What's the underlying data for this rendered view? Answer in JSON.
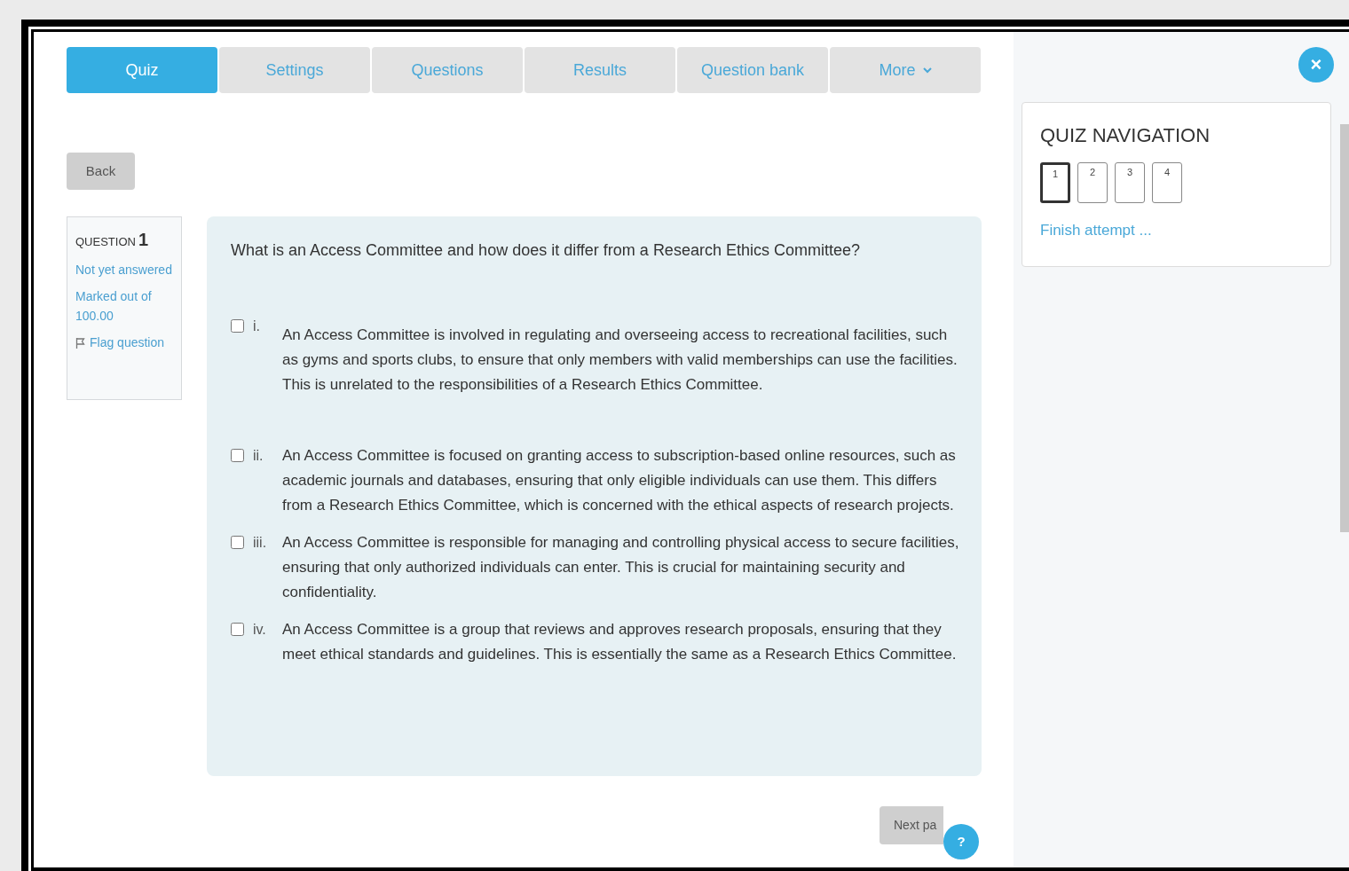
{
  "tabs": [
    {
      "label": "Quiz",
      "selected": true
    },
    {
      "label": "Settings",
      "selected": false
    },
    {
      "label": "Questions",
      "selected": false
    },
    {
      "label": "Results",
      "selected": false
    },
    {
      "label": "Question bank",
      "selected": false
    },
    {
      "label": "More",
      "selected": false,
      "dropdown": true
    }
  ],
  "back_button": "Back",
  "question_info": {
    "heading": "QUESTION",
    "number": "1",
    "state": "Not yet answered",
    "marks": "Marked out of 100.00",
    "flag": "Flag question"
  },
  "question": {
    "text": "What is an Access Committee and how does it differ from a Research Ethics Committee?",
    "options": [
      {
        "label": "i.",
        "checked": false,
        "text": "An Access Committee is involved in regulating and overseeing access to recreational facilities, such as gyms and sports clubs, to ensure that only members with valid memberships can use the facilities. This is unrelated to the responsibilities of a Research Ethics Committee."
      },
      {
        "label": "ii.",
        "checked": false,
        "text": "An Access Committee is focused on granting access to subscription-based online resources, such as academic journals and databases, ensuring that only eligible individuals can use them. This differs from a Research Ethics Committee, which is concerned with the ethical aspects of research projects."
      },
      {
        "label": "iii.",
        "checked": false,
        "text": "An Access Committee is responsible for managing and controlling physical access to secure facilities, ensuring that only authorized individuals can enter. This is crucial for maintaining security and confidentiality."
      },
      {
        "label": "iv.",
        "checked": false,
        "text": "An Access Committee is a group that reviews and approves research proposals, ensuring that they meet ethical standards and guidelines. This is essentially the same as a Research Ethics Committee."
      }
    ]
  },
  "next_button": "Next pa",
  "help_button": "?",
  "close_button": "×",
  "quiz_navigation": {
    "title": "QUIZ NAVIGATION",
    "pages": [
      {
        "label": "1",
        "selected": true
      },
      {
        "label": "2",
        "selected": false
      },
      {
        "label": "3",
        "selected": false
      },
      {
        "label": "4",
        "selected": false
      }
    ],
    "finish": "Finish attempt ..."
  }
}
